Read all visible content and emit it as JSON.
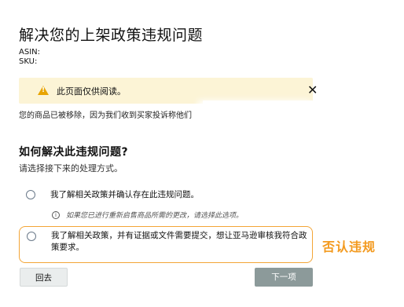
{
  "header": {
    "title": "解决您的上架政策违规问题",
    "asin_label": "ASIN:",
    "sku_label": "SKU:"
  },
  "alert": {
    "icon": "warning-icon",
    "text": "此页面仅供阅读。",
    "close_symbol": "✕"
  },
  "notice": {
    "text": "您的商品已被移除，因为我们收到买家投诉称他们"
  },
  "resolution": {
    "title": "如何解决此违规问题?",
    "subtitle": "请选择接下来的处理方式。",
    "options": [
      {
        "label": "我了解相关政策并确认存在此违规问题。",
        "selected": false
      },
      {
        "label": "我了解相关政策，并有证据或文件需要提交，想让亚马逊审核我符合政策要求。",
        "selected": false
      }
    ],
    "note": "如果您已进行重新启售商品所需的更改，请选择此选项。",
    "note_icon": "i"
  },
  "annotation": {
    "text": "否认违规",
    "color": "#f39a1f"
  },
  "footer": {
    "back_label": "回去",
    "next_label": "下一项"
  }
}
